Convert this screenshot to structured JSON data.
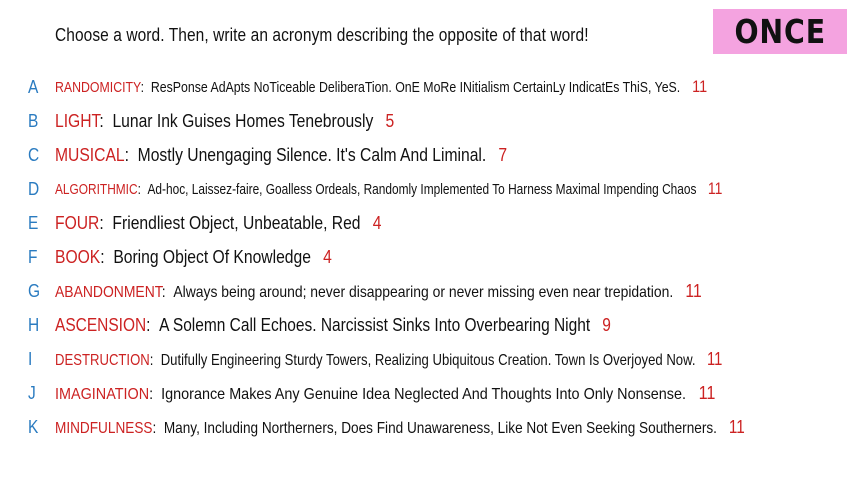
{
  "instructions": "Choose a word. Then, write an acronym describing the opposite of that word!",
  "badge": {
    "text": "ONCE",
    "color": "#f4a3e0"
  },
  "colors": {
    "letter": "#2a7bc0",
    "word": "#cc2222",
    "count": "#cc2222",
    "text": "#111111"
  },
  "entries": [
    {
      "letter": "A",
      "word": "RANDOMICITY",
      "phrase": "ResPonse AdApts NoTiceable DeliberaTion. OnE MoRe INitialism CertainLy IndicatEs ThiS, YeS.",
      "count": "11"
    },
    {
      "letter": "B",
      "word": "LIGHT",
      "phrase": "Lunar Ink Guises Homes Tenebrously",
      "count": "5"
    },
    {
      "letter": "C",
      "word": "MUSICAL",
      "phrase": "Mostly Unengaging Silence. It's Calm And Liminal.",
      "count": "7"
    },
    {
      "letter": "D",
      "word": "ALGORITHMIC",
      "phrase": "Ad-hoc, Laissez-faire, Goalless Ordeals, Randomly Implemented To Harness Maximal Impending Chaos",
      "count": "11"
    },
    {
      "letter": "E",
      "word": "FOUR",
      "phrase": "Friendliest Object, Unbeatable, Red",
      "count": "4"
    },
    {
      "letter": "F",
      "word": "BOOK",
      "phrase": "Boring Object Of Knowledge",
      "count": "4"
    },
    {
      "letter": "G",
      "word": "ABANDONMENT",
      "phrase": "Always being around; never disappearing or never missing even near trepidation.",
      "count": "11"
    },
    {
      "letter": "H",
      "word": "ASCENSION",
      "phrase": "A Solemn Call Echoes. Narcissist Sinks Into Overbearing Night",
      "count": "9"
    },
    {
      "letter": "I",
      "word": "DESTRUCTION",
      "phrase": "Dutifully Engineering Sturdy Towers, Realizing Ubiquitous Creation. Town Is Overjoyed Now.",
      "count": "11"
    },
    {
      "letter": "J",
      "word": "IMAGINATION",
      "phrase": "Ignorance Makes Any Genuine Idea Neglected And Thoughts Into Only Nonsense.",
      "count": "11"
    },
    {
      "letter": "K",
      "word": "MINDFULNESS",
      "phrase": "Many, Including Northerners, Does Find Unawareness, Like Not Even Seeking Southerners.",
      "count": "11"
    }
  ]
}
